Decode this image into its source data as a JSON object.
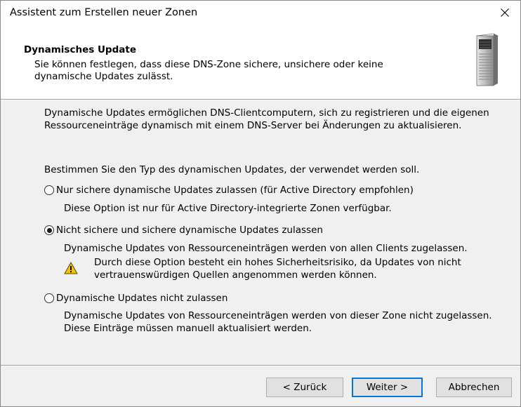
{
  "window": {
    "title": "Assistent zum Erstellen neuer Zonen"
  },
  "header": {
    "title": "Dynamisches Update",
    "description": "Sie können festlegen, dass diese DNS-Zone sichere, unsichere oder keine dynamische Updates zulässt."
  },
  "content": {
    "intro": "Dynamische Updates ermöglichen DNS-Clientcomputern, sich zu registrieren und die eigenen Ressourceneinträge dynamisch mit einem DNS-Server bei Änderungen zu aktualisieren.",
    "question": "Bestimmen Sie den Typ des dynamischen Updates, der verwendet werden soll.",
    "options": [
      {
        "label": "Nur sichere dynamische Updates zulassen (für Active Directory empfohlen)",
        "description": "Diese Option ist nur für Active Directory-integrierte Zonen verfügbar.",
        "selected": false
      },
      {
        "label": "Nicht sichere und sichere dynamische Updates zulassen",
        "description": "Dynamische Updates von Ressourceneinträgen werden von allen Clients zugelassen.",
        "warning": "Durch diese Option besteht ein hohes Sicherheitsrisiko, da Updates von nicht vertrauenswürdigen Quellen angenommen werden können.",
        "selected": true
      },
      {
        "label": "Dynamische Updates nicht zulassen",
        "description": "Dynamische Updates von Ressourceneinträgen werden von dieser Zone nicht zugelassen. Diese Einträge müssen manuell aktualisiert werden.",
        "selected": false
      }
    ]
  },
  "buttons": {
    "back": "< Zurück",
    "next": "Weiter >",
    "cancel": "Abbrechen"
  },
  "icons": {
    "close": "close-icon",
    "server": "server-icon",
    "warning": "warning-icon"
  },
  "colors": {
    "default_button_border": "#0078d7",
    "warning_fill": "#f5c400"
  }
}
